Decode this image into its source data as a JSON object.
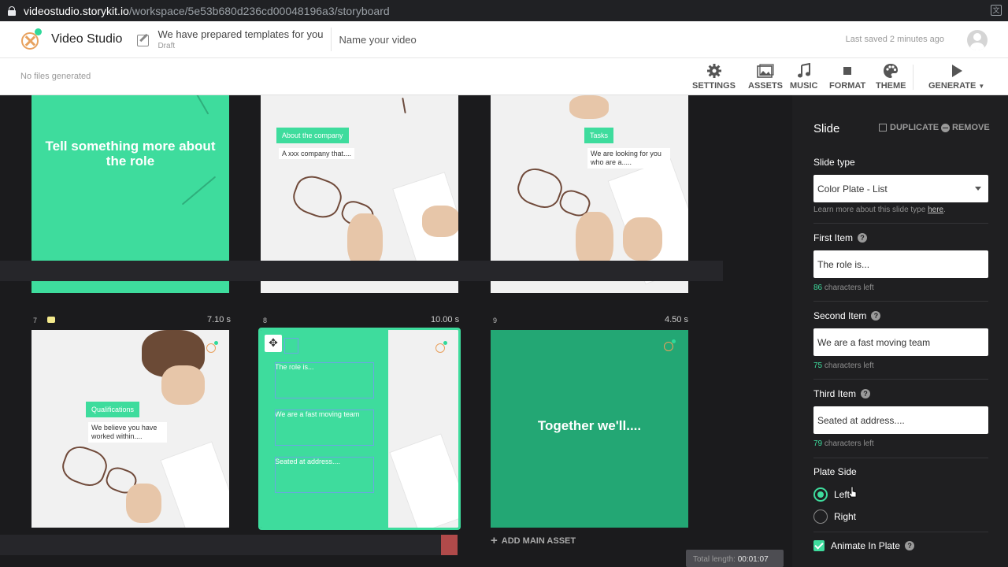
{
  "browser": {
    "url_host": "videostudio.storykit.io",
    "url_path": "/workspace/5e53b680d236cd00048196a3/storyboard"
  },
  "header": {
    "app_title": "Video Studio",
    "template_title": "We have prepared templates for you",
    "template_status": "Draft",
    "video_name_placeholder": "Name your video",
    "last_saved": "Last saved 2 minutes ago"
  },
  "toolbar": {
    "status": "No files generated",
    "items": [
      {
        "label": "SETTINGS",
        "icon": "gear-icon"
      },
      {
        "label": "ASSETS",
        "icon": "image-icon"
      },
      {
        "label": "MUSIC",
        "icon": "music-note-icon"
      },
      {
        "label": "FORMAT",
        "icon": "square-icon"
      },
      {
        "label": "THEME",
        "icon": "palette-icon"
      },
      {
        "label": "GENERATE",
        "icon": "play-icon"
      }
    ]
  },
  "slides_top": [
    {
      "type": "text",
      "text": "Tell something more about the role"
    },
    {
      "type": "photo",
      "tag": "About the company",
      "sub": "A xxx company that...."
    },
    {
      "type": "photo",
      "tag": "Tasks",
      "sub": "We are looking for you who are a....."
    }
  ],
  "slides_bottom": [
    {
      "number": "7",
      "duration": "7.10 s",
      "tag": "Qualifications",
      "sub": "We believe you have worked within...."
    },
    {
      "number": "8",
      "duration": "10.00 s",
      "items": [
        "The role is...",
        "We are a fast moving team",
        "Seated at address...."
      ]
    },
    {
      "number": "9",
      "duration": "4.50 s",
      "text": "Together we'll...."
    }
  ],
  "board": {
    "add_main_asset": "ADD MAIN ASSET",
    "total_length_label": "Total length:",
    "total_length_value": "00:01:07"
  },
  "panel": {
    "title": "Slide",
    "duplicate": "DUPLICATE",
    "remove": "REMOVE",
    "slide_type_label": "Slide type",
    "slide_type_value": "Color Plate - List",
    "slide_type_hint": "Learn more about this slide type",
    "slide_type_hint_link": "here",
    "first_item_label": "First Item",
    "first_item_value": "The role is...",
    "first_item_count": "86",
    "second_item_label": "Second Item",
    "second_item_value": "We are a fast moving team",
    "second_item_count": "75",
    "third_item_label": "Third Item",
    "third_item_value": "Seated at address....",
    "third_item_count": "79",
    "chars_left": "characters left",
    "plate_side_label": "Plate Side",
    "plate_side_options": [
      "Left",
      "Right"
    ],
    "plate_side_selected": "Left",
    "animate_label": "Animate In Plate",
    "animate_checked": true
  },
  "colors": {
    "accent_green": "#3edc9d",
    "dark_bg": "#1b1b1d",
    "logo_orange": "#e8a25f"
  }
}
